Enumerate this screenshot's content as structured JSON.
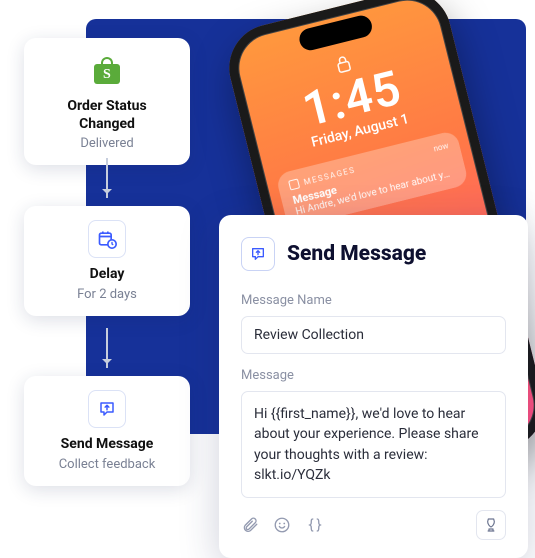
{
  "workflow": {
    "step1": {
      "title": "Order Status Changed",
      "subtitle": "Delivered"
    },
    "step2": {
      "title": "Delay",
      "subtitle": "For 2 days"
    },
    "step3": {
      "title": "Send Message",
      "subtitle": "Collect feedback"
    }
  },
  "phone": {
    "time": "1:45",
    "date": "Friday, August 1",
    "notification": {
      "app": "MESSAGES",
      "when": "now",
      "title": "Message",
      "body": "Hi Andre, we'd love to hear about your..."
    }
  },
  "panel": {
    "heading": "Send Message",
    "name_label": "Message Name",
    "name_value": "Review Collection",
    "message_label": "Message",
    "message_value": "Hi {{first_name}}, we'd love to hear about your experience. Please share your thoughts with a review: slkt.io/YQZk"
  }
}
